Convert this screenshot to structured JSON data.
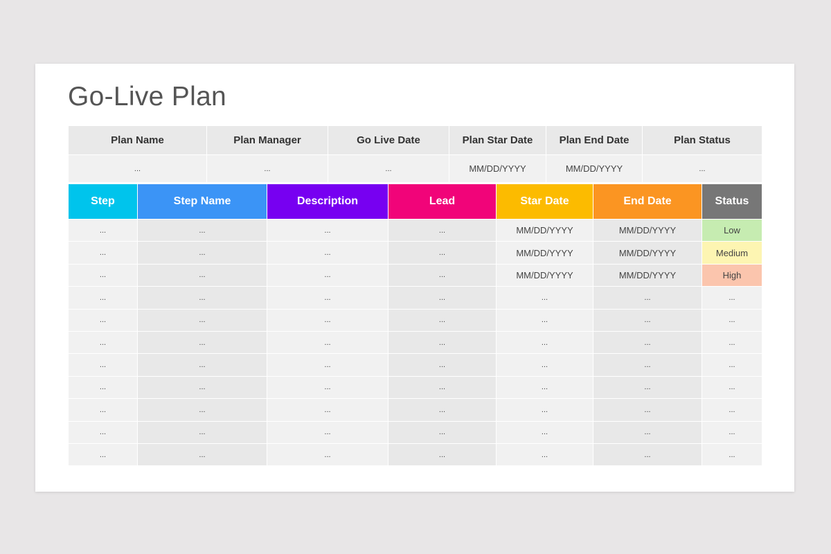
{
  "title": "Go-Live Plan",
  "summary": {
    "headers": [
      "Plan Name",
      "Plan Manager",
      "Go Live Date",
      "Plan Star Date",
      "Plan End Date",
      "Plan Status"
    ],
    "values": [
      "...",
      "...",
      "...",
      "MM/DD/YYYY",
      "MM/DD/YYYY",
      "..."
    ]
  },
  "steps_table": {
    "headers": [
      {
        "label": "Step",
        "color": "#00c4ec"
      },
      {
        "label": "Step Name",
        "color": "#3b94f6"
      },
      {
        "label": "Description",
        "color": "#7700f1"
      },
      {
        "label": "Lead",
        "color": "#f10479"
      },
      {
        "label": "Star Date",
        "color": "#fcbb00"
      },
      {
        "label": "End Date",
        "color": "#fb9522"
      },
      {
        "label": "Status",
        "color": "#777777"
      }
    ],
    "status_colors": {
      "Low": "#c6ecb1",
      "Medium": "#fdf5b2",
      "High": "#fbc5ad"
    },
    "rows": [
      [
        "...",
        "...",
        "...",
        "...",
        "MM/DD/YYYY",
        "MM/DD/YYYY",
        "Low"
      ],
      [
        "...",
        "...",
        "...",
        "...",
        "MM/DD/YYYY",
        "MM/DD/YYYY",
        "Medium"
      ],
      [
        "...",
        "...",
        "...",
        "...",
        "MM/DD/YYYY",
        "MM/DD/YYYY",
        "High"
      ],
      [
        "...",
        "...",
        "...",
        "...",
        "...",
        "...",
        "..."
      ],
      [
        "...",
        "...",
        "...",
        "...",
        "...",
        "...",
        "..."
      ],
      [
        "...",
        "...",
        "...",
        "...",
        "...",
        "...",
        "..."
      ],
      [
        "...",
        "...",
        "...",
        "...",
        "...",
        "...",
        "..."
      ],
      [
        "...",
        "...",
        "...",
        "...",
        "...",
        "...",
        "..."
      ],
      [
        "...",
        "...",
        "...",
        "...",
        "...",
        "...",
        "..."
      ],
      [
        "...",
        "...",
        "...",
        "...",
        "...",
        "...",
        "..."
      ],
      [
        "...",
        "...",
        "...",
        "...",
        "...",
        "...",
        "..."
      ]
    ]
  }
}
